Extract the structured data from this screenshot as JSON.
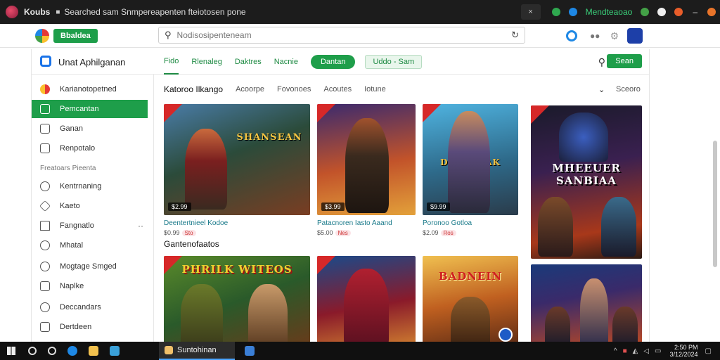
{
  "browser": {
    "app_name": "Koubs",
    "url": "Searched sam Snmpereapenten fteiotosen pone",
    "tab_close": "×",
    "extension_label": "Mendteaoao",
    "window_controls": {
      "minimize": "–",
      "maximize": "□",
      "close": "✕"
    }
  },
  "appbar": {
    "badge": "Bbaldea",
    "search_placeholder": "Nodisosipenteneam"
  },
  "panel": {
    "title": "Unat Aphilganan",
    "tabs": [
      "Fido",
      "Rlenaleg",
      "Daktres",
      "Nacnie"
    ],
    "pill_primary": "Dantan",
    "pill_secondary": "Uddo - Sam",
    "action_button": "Sean"
  },
  "sidebar": {
    "items": [
      {
        "label": "Karianotopetned",
        "icon": "game-icon"
      },
      {
        "label": "Pemcantan",
        "icon": "store-icon",
        "active": true
      },
      {
        "label": "Ganan",
        "icon": "library-icon"
      },
      {
        "label": "Renpotalo",
        "icon": "document-icon"
      }
    ],
    "section_label": "Freatoars Pieenta",
    "items2": [
      {
        "label": "Kentrnaning",
        "icon": "chat-icon"
      },
      {
        "label": "Kaeto",
        "icon": "tag-icon"
      },
      {
        "label": "Fangnatlo",
        "icon": "home-icon",
        "more": "··"
      },
      {
        "label": "Mhatal",
        "icon": "users-icon"
      },
      {
        "label": "Mogtage Smged",
        "icon": "clock-icon"
      },
      {
        "label": "Naplke",
        "icon": "list-icon"
      },
      {
        "label": "Deccandars",
        "icon": "grid-icon"
      },
      {
        "label": "Dertdeen",
        "icon": "box-icon"
      }
    ]
  },
  "content": {
    "categories": {
      "main": "Katoroo Ilkango",
      "others": [
        "Acoorpe",
        "Fovonoes",
        "Acoutes",
        "Iotune"
      ],
      "more": "Sceoro"
    },
    "section2_title": "Gantenofaatos",
    "cards_row1": [
      {
        "art_title": "SHANSEAN",
        "price": "$2.99",
        "name": "Deentertnieel Kodoe",
        "meta": "$0.99",
        "tag": "Sto"
      },
      {
        "art_title": "",
        "price": "$3.99",
        "name": "Patacnoren Iasto Aaand",
        "meta": "$5.00",
        "tag": "Nes"
      },
      {
        "art_title": "DHUENIAK",
        "price": "$9.99",
        "name": "Poronoo Gotloa",
        "meta": "$2.09",
        "tag": "Ros"
      },
      {
        "art_title": "MHEEUER SANBIAA",
        "price": "",
        "name": "",
        "meta": "",
        "tag": ""
      }
    ],
    "cards_row2": [
      {
        "art_title": "PHRILK WITEOS"
      },
      {
        "art_title": ""
      },
      {
        "art_title": "BADNEIN"
      },
      {
        "art_title": ""
      }
    ]
  },
  "taskbar": {
    "active_app": "Suntohinan",
    "clock_time": "2:50 PM",
    "clock_date": "3/12/2024"
  },
  "colors": {
    "brand_green": "#1e9e4a",
    "titlebar": "#1c1c1c",
    "taskbar": "#101010"
  }
}
